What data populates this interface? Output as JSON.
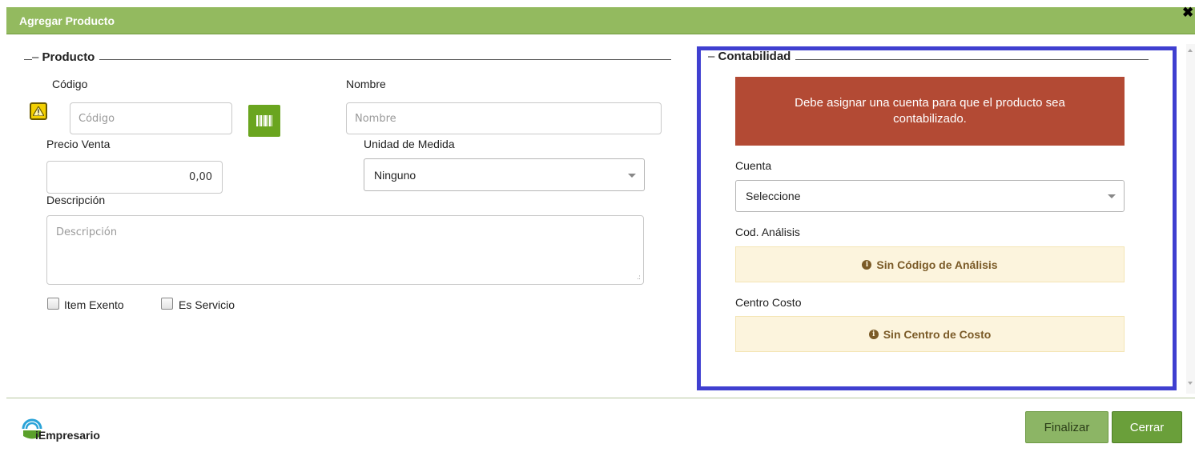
{
  "dialog": {
    "title": "Agregar Producto",
    "close_symbol": "✖"
  },
  "producto": {
    "legend": "Producto",
    "codigo": {
      "label": "Código",
      "placeholder": "Código"
    },
    "nombre": {
      "label": "Nombre",
      "placeholder": "Nombre"
    },
    "precio_venta": {
      "label": "Precio Venta",
      "value": "0,00"
    },
    "unidad_medida": {
      "label": "Unidad de Medida",
      "selected": "Ninguno"
    },
    "descripcion": {
      "label": "Descripción",
      "placeholder": "Descripción"
    },
    "checkboxes": [
      {
        "label": "Item Exento",
        "checked": false
      },
      {
        "label": "Es Servicio",
        "checked": false
      }
    ]
  },
  "contabilidad": {
    "legend": "Contabilidad",
    "alert": "Debe asignar una cuenta para que el producto sea contabilizado.",
    "cuenta": {
      "label": "Cuenta",
      "selected": "Seleccione"
    },
    "cod_analisis": {
      "label": "Cod. Análisis",
      "info": "Sin Código de Análisis"
    },
    "centro_costo": {
      "label": "Centro Costo",
      "info": "Sin Centro de Costo"
    }
  },
  "footer": {
    "logo_text": "iEmpresario",
    "finalizar_label": "Finalizar",
    "cerrar_label": "Cerrar"
  },
  "colors": {
    "titlebar": "#93ba5f",
    "alert": "#b34a34",
    "highlight_border": "#3f3fd0",
    "info_bg": "#fcf4dd",
    "button_green": "#6a9f3a"
  },
  "icons": [
    "warning-icon",
    "barcode-icon",
    "close-icon",
    "info-icon",
    "dropdown-caret-icon",
    "logo-icon"
  ]
}
